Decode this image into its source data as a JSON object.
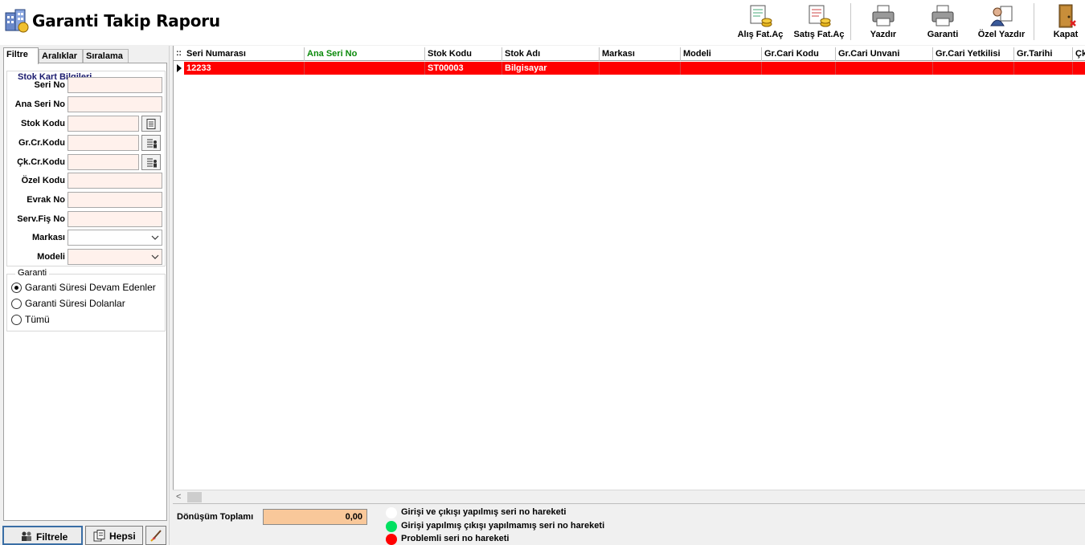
{
  "window": {
    "title": "Garanti Takip Raporu"
  },
  "toolbar": {
    "alis_fat": "Alış Fat.Aç",
    "satis_fat": "Satış Fat.Aç",
    "yazdir": "Yazdır",
    "garanti": "Garanti",
    "ozel_yazdir": "Özel Yazdır",
    "kapat": "Kapat"
  },
  "tabs": [
    "Filtre",
    "Aralıklar",
    "Sıralama"
  ],
  "filter": {
    "group_title": "Stok Kart Bilgileri",
    "seri_no": "Seri No",
    "ana_seri_no": "Ana Seri No",
    "stok_kodu": "Stok Kodu",
    "gr_cr_kodu": "Gr.Cr.Kodu",
    "ck_cr_kodu": "Çk.Cr.Kodu",
    "ozel_kodu": "Özel Kodu",
    "evrak_no": "Evrak No",
    "serv_fis_no": "Serv.Fiş No",
    "markasi": "Markası",
    "modeli": "Modeli"
  },
  "garanti": {
    "title": "Garanti",
    "options": [
      "Garanti Süresi Devam Edenler",
      "Garanti Süresi Dolanlar",
      "Tümü"
    ],
    "selected": "Garanti Süresi Devam Edenler"
  },
  "buttons": {
    "filtrele": "Filtrele",
    "hepsi": "Hepsi"
  },
  "grid": {
    "columns": [
      "Seri Numarası",
      "Ana Seri No",
      "Stok Kodu",
      "Stok Adı",
      "Markası",
      "Modeli",
      "Gr.Cari Kodu",
      "Gr.Cari Unvani",
      "Gr.Cari Yetkilisi",
      "Gr.Tarihi",
      "Çk"
    ],
    "rows": [
      {
        "seri_numarasi": "12233",
        "ana_seri_no": "",
        "stok_kodu": "ST00003",
        "stok_adi": "Bilgisayar",
        "markasi": "",
        "modeli": "",
        "gr_cari_kodu": "",
        "gr_cari_unvani": "",
        "gr_cari_yetkilisi": "",
        "gr_tarihi": ""
      }
    ],
    "row_color": "#ff0000"
  },
  "footer": {
    "donusum_label": "Dönüşüm Toplamı",
    "donusum_value": "0,00",
    "legend": [
      {
        "text": "Girişi ve çıkışı yapılmış seri no hareketi",
        "color": "#ffffff"
      },
      {
        "text": "Girişi yapılmış çıkışı yapılmamış seri no hareketi",
        "color": "#00e060"
      },
      {
        "text": "Problemli seri no hareketi",
        "color": "#ff0000"
      }
    ]
  }
}
